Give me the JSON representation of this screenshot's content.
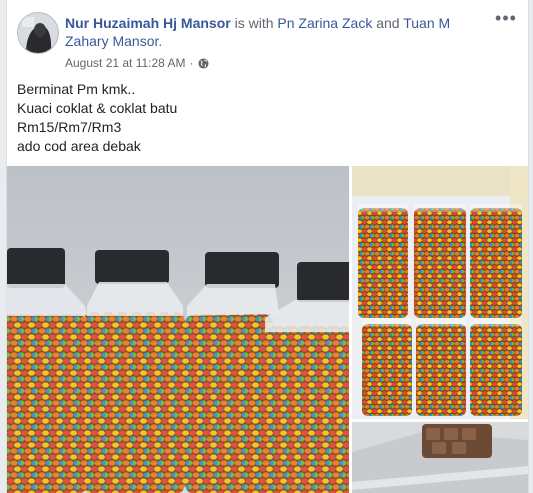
{
  "post": {
    "author": "Nur Huzaimah Hj Mansor",
    "with_text": "is with",
    "tag1": "Pn Zarina Zack",
    "and_text": "and",
    "tag2": "Tuan M Zahary Mansor",
    "period": ".",
    "timestamp": "August 21 at 11:28 AM",
    "separator": "·",
    "privacy_icon": "globe-icon",
    "more_icon": "more-options-icon",
    "more_glyph": "•••",
    "text_lines": [
      "Berminat Pm kmk..",
      "Kuaci coklat & coklat batu",
      "Rm15/Rm7/Rm3",
      "ado cod area debak"
    ]
  },
  "photos": [
    {
      "name": "candy-jars-photo",
      "description_icon": "photo"
    },
    {
      "name": "candy-containers-photo",
      "description_icon": "photo"
    },
    {
      "name": "chocolate-box-photo",
      "description_icon": "photo"
    }
  ],
  "colors": {
    "link": "#385898",
    "text": "#1d2129",
    "meta": "#616770",
    "background": "#e9ebee"
  }
}
